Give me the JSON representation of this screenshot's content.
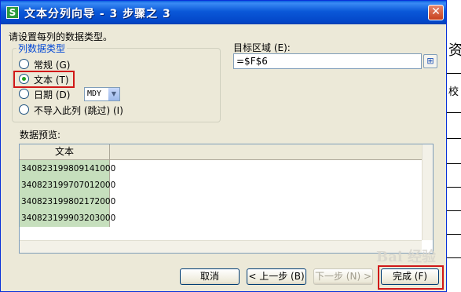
{
  "window": {
    "title": "文本分列向导 - 3 步骤之 3",
    "app_icon_letter": "S",
    "close_glyph": "✕"
  },
  "instruction": "请设置每列的数据类型。",
  "column_type_group": {
    "legend": "列数据类型",
    "options": [
      {
        "label": "常规 (G)",
        "checked": false
      },
      {
        "label": "文本 (T)",
        "checked": true
      },
      {
        "label": "日期 (D)",
        "checked": false
      },
      {
        "label": "不导入此列 (跳过) (I)",
        "checked": false
      }
    ],
    "date_format": "MDY"
  },
  "destination": {
    "label": "目标区域 (E):",
    "value": "=$F$6"
  },
  "preview": {
    "label": "数据预览:",
    "column_header": "文本",
    "rows": [
      "340823199809141000",
      "340823199707012000",
      "340823199802172000",
      "340823199903203000"
    ]
  },
  "buttons": {
    "cancel": "取消",
    "back": "< 上一步 (B)",
    "next": "下一步 (N) >",
    "finish": "完成 (F)"
  },
  "background": {
    "glyph_1": "资",
    "glyph_2": "校"
  },
  "watermark": "Bai 经验",
  "colors": {
    "highlight": "#d01818",
    "titlebar": "#0a58d8",
    "preview_column": "#c6dfbd"
  }
}
